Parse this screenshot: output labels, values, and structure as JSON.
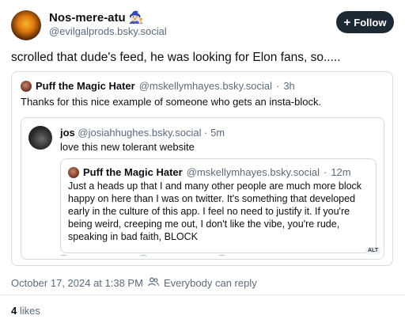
{
  "post": {
    "author_name": "Nos-mere-atu",
    "author_emoji": "🧙🏻‍♀️",
    "author_handle": "@evilgalprods.bsky.social",
    "follow_label": "Follow",
    "text": "scrolled that dude's feed, he was looking for Elon fans, so.....",
    "timestamp": "October 17, 2024 at 1:38 PM",
    "reply_setting": "Everybody can reply",
    "likes_count": "4",
    "likes_label": "likes"
  },
  "quote1": {
    "author_name": "Puff the Magic Hater",
    "author_handle": "@mskellymhayes.bsky.social",
    "separator": "·",
    "time": "3h",
    "text": "Thanks for this nice example of someone who gets an insta-block."
  },
  "quote2": {
    "author_name": "jos",
    "author_handle": "@josiahhughes.bsky.social",
    "separator": "·",
    "time": "5m",
    "text": "love this new tolerant website"
  },
  "quote3": {
    "author_name": "Puff the Magic Hater",
    "author_handle": "@mskellymhayes.bsky.social",
    "separator": "·",
    "time": "12m",
    "text": "Just a heads up that I and many other people are much more block happy on here than I was on twitter. It's something that developed early in the culture of this app. I feel no need to justify it. If you're being weird, creeping me out, I don't like the vibe, you're rude, speaking in bad faith, BLOCK",
    "alt_badge": "ALT"
  },
  "icons": {
    "follow": "plus-icon",
    "reply_setting": "people-icon"
  }
}
